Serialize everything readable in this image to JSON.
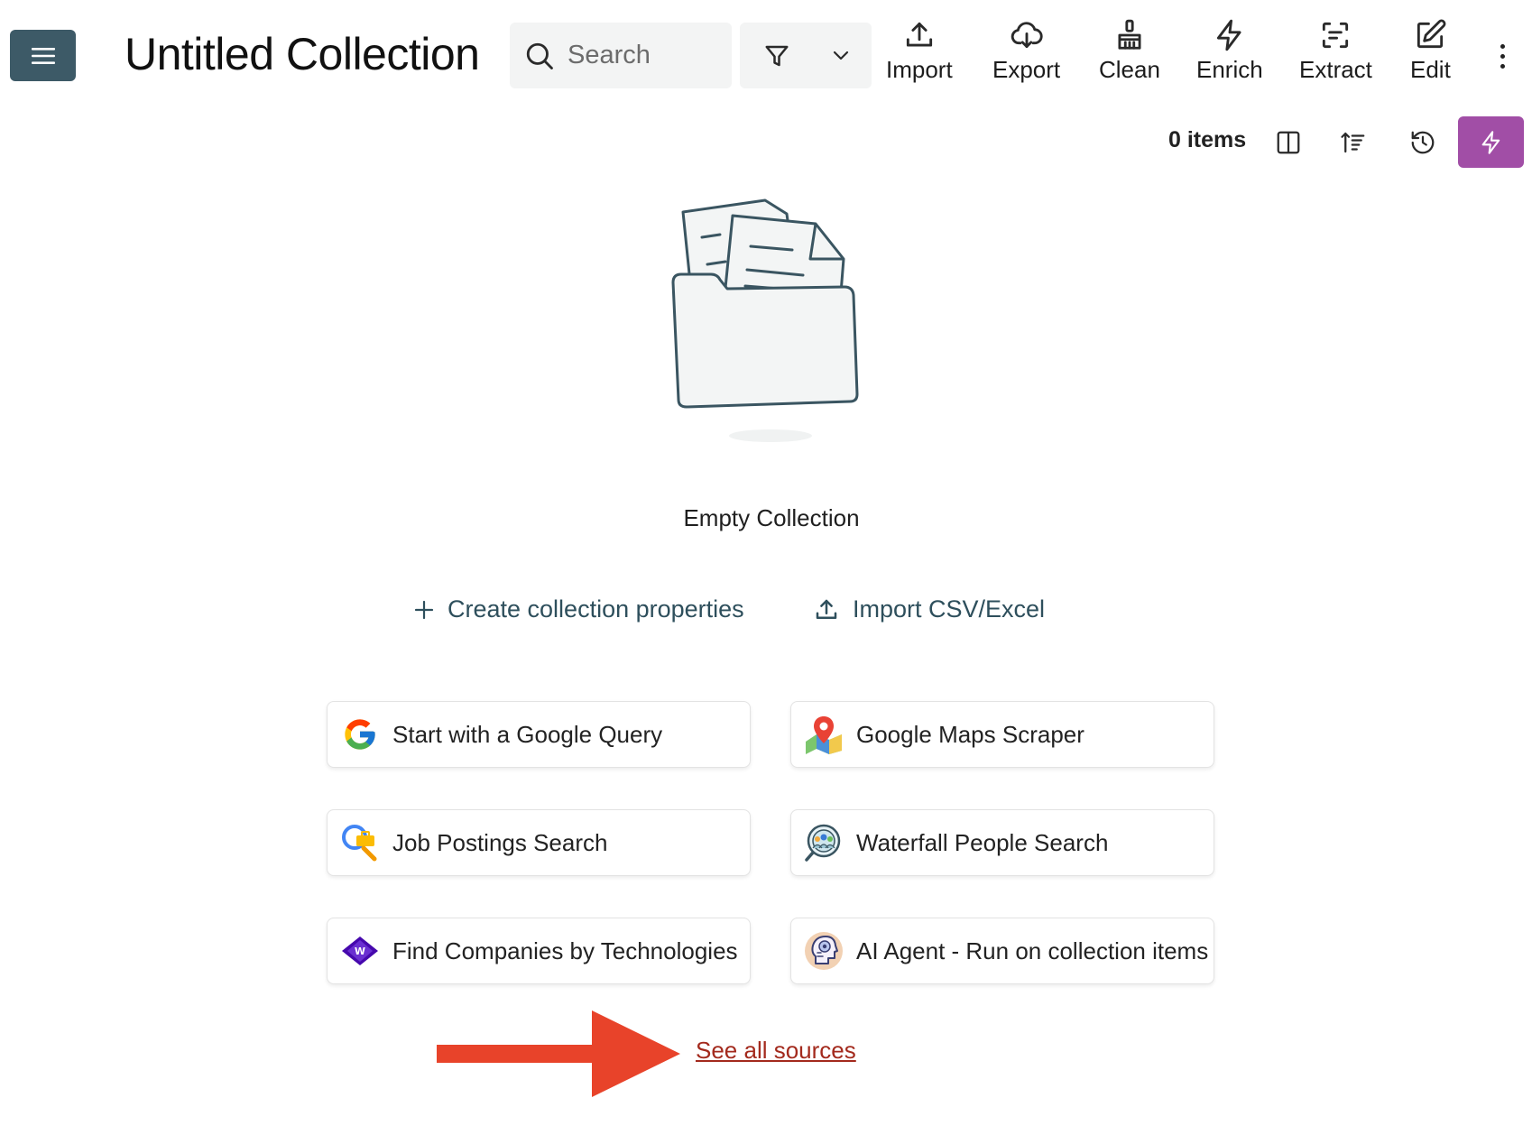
{
  "header": {
    "title": "Untitled Collection",
    "search_placeholder": "Search",
    "tools": {
      "import": "Import",
      "export": "Export",
      "clean": "Clean",
      "enrich": "Enrich",
      "extract": "Extract",
      "edit": "Edit"
    }
  },
  "toolbar": {
    "items_count": "0 items"
  },
  "empty_state": {
    "title": "Empty Collection",
    "create_properties": "Create collection properties",
    "import_csv": "Import CSV/Excel"
  },
  "sources": {
    "google_query": "Start with a Google Query",
    "google_maps": "Google Maps Scraper",
    "job_postings": "Job Postings Search",
    "waterfall_people": "Waterfall People Search",
    "find_companies": "Find Companies by Technologies",
    "ai_agent": "AI Agent - Run on collection items",
    "see_all": "See all sources"
  },
  "colors": {
    "menu_button": "#3d5a67",
    "accent_bolt": "#a14ea6",
    "link_teal": "#2e4f5c",
    "see_all_link": "#a32a1d",
    "arrow": "#e8432a"
  }
}
